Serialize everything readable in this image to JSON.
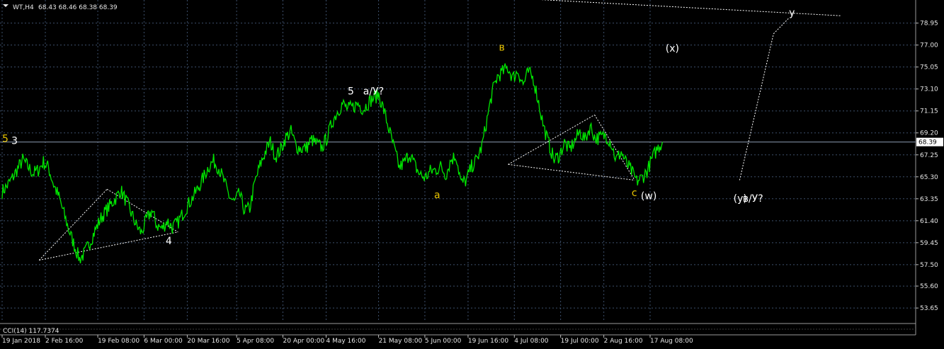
{
  "header": {
    "symbol": "WT,H4",
    "ohlc": "68.43 68.46 68.38 68.39"
  },
  "colors": {
    "background": "#000000",
    "price": "#00e600",
    "grid": "#3d4f6b",
    "axis_text": "#e6e6e6",
    "wave_yellow": "#e8c400",
    "wave_white": "#ffffff",
    "projection": "#ffffff"
  },
  "chart_data": {
    "type": "line",
    "instrument": "WT",
    "timeframe": "H4",
    "ylim": [
      52.4,
      81.0
    ],
    "y_ticks": [
      "78.95",
      "77.00",
      "75.05",
      "73.10",
      "71.15",
      "69.20",
      "67.25",
      "65.30",
      "63.35",
      "61.40",
      "59.45",
      "57.50",
      "55.60",
      "53.65"
    ],
    "current_price": "68.39",
    "x_ticks": [
      "19 Jan 2018",
      "2 Feb 16:00",
      "19 Feb 08:00",
      "6 Mar 00:00",
      "20 Mar 16:00",
      "5 Apr 08:00",
      "20 Apr 00:00",
      "4 May 16:00",
      "21 May 08:00",
      "5 Jun 00:00",
      "19 Jun 16:00",
      "4 Jul 08:00",
      "19 Jul 00:00",
      "2 Aug 16:00",
      "17 Aug 08:00"
    ],
    "series": [
      {
        "values": [
          64.0,
          64.5,
          65.2,
          66.0,
          66.8,
          66.2,
          65.6,
          65.9,
          66.6,
          66.1,
          64.6,
          63.5,
          62.0,
          60.5,
          59.2,
          58.0,
          58.5,
          59.5,
          60.5,
          61.5,
          62.2,
          62.8,
          63.4,
          64.1,
          63.2,
          62.1,
          61.0,
          60.3,
          61.5,
          62.3,
          61.0,
          60.7,
          61.4,
          60.8,
          61.2,
          62.0,
          62.8,
          63.5,
          64.3,
          65.2,
          66.2,
          66.7,
          66.1,
          64.9,
          63.6,
          63.0,
          63.8,
          62.3,
          62.5,
          64.8,
          66.3,
          67.5,
          68.4,
          67.1,
          67.7,
          68.8,
          69.3,
          68.0,
          67.8,
          67.9,
          68.6,
          68.2,
          67.9,
          68.8,
          70.2,
          71.1,
          71.8,
          71.3,
          71.5,
          71.8,
          71.3,
          71.9,
          72.3,
          72.6,
          71.2,
          69.5,
          67.8,
          66.1,
          66.6,
          67.4,
          66.3,
          65.5,
          65.2,
          65.8,
          65.9,
          66.2,
          65.5,
          66.8,
          67.2,
          64.7,
          65.0,
          66.2,
          66.8,
          68.0,
          70.4,
          72.8,
          74.2,
          74.6,
          75.0,
          74.1,
          74.7,
          73.5,
          74.6,
          74.0,
          71.9,
          69.7,
          68.2,
          66.8,
          67.2,
          68.3,
          67.7,
          68.5,
          69.3,
          68.6,
          69.8,
          68.7,
          68.8,
          69.0,
          68.4,
          66.8,
          67.5,
          66.5,
          65.8,
          64.9,
          65.2,
          65.8,
          66.9,
          67.8,
          68.4
        ],
        "min": 57.9,
        "max": 75.1,
        "start_date": "19 Jan 2018",
        "end_date": "21 Aug 2018"
      }
    ],
    "wave_labels": [
      {
        "text": "5",
        "color": "yellow",
        "date": "19 Jan 2018",
        "price": 68.4
      },
      {
        "text": "3",
        "color": "white",
        "date": "22 Jan 2018",
        "price": 68.2
      },
      {
        "text": "4",
        "color": "white",
        "date": "13 Mar 2018",
        "price": 59.3
      },
      {
        "text": "5",
        "color": "white",
        "date": "11 May 2018",
        "price": 72.6
      },
      {
        "text": "a/У?",
        "color": "white",
        "date": "16 May 2018",
        "price": 72.6
      },
      {
        "text": "a",
        "color": "yellow",
        "date": "8 Jun 2018",
        "price": 63.4
      },
      {
        "text": "в",
        "color": "yellow",
        "date": "29 Jun 2018",
        "price": 76.5
      },
      {
        "text": "с",
        "color": "yellow",
        "date": "11 Aug 2018",
        "price": 63.6
      },
      {
        "text": "(w)",
        "color": "white",
        "date": "14 Aug 2018",
        "price": 63.3
      },
      {
        "text": "(x)",
        "color": "white",
        "date": "22 Aug 2018",
        "price": 76.4
      },
      {
        "text": "(y)",
        "color": "white",
        "date": "13 Sep 2018",
        "price": 63.1
      },
      {
        "text": "в/У?",
        "color": "white",
        "date": "16 Sep 2018",
        "price": 63.1
      },
      {
        "text": "у",
        "color": "white",
        "date": "1 Oct 2018",
        "price": 79.6
      }
    ],
    "indicator": {
      "label": "CCI(14) 117.7374"
    },
    "grid": true
  }
}
